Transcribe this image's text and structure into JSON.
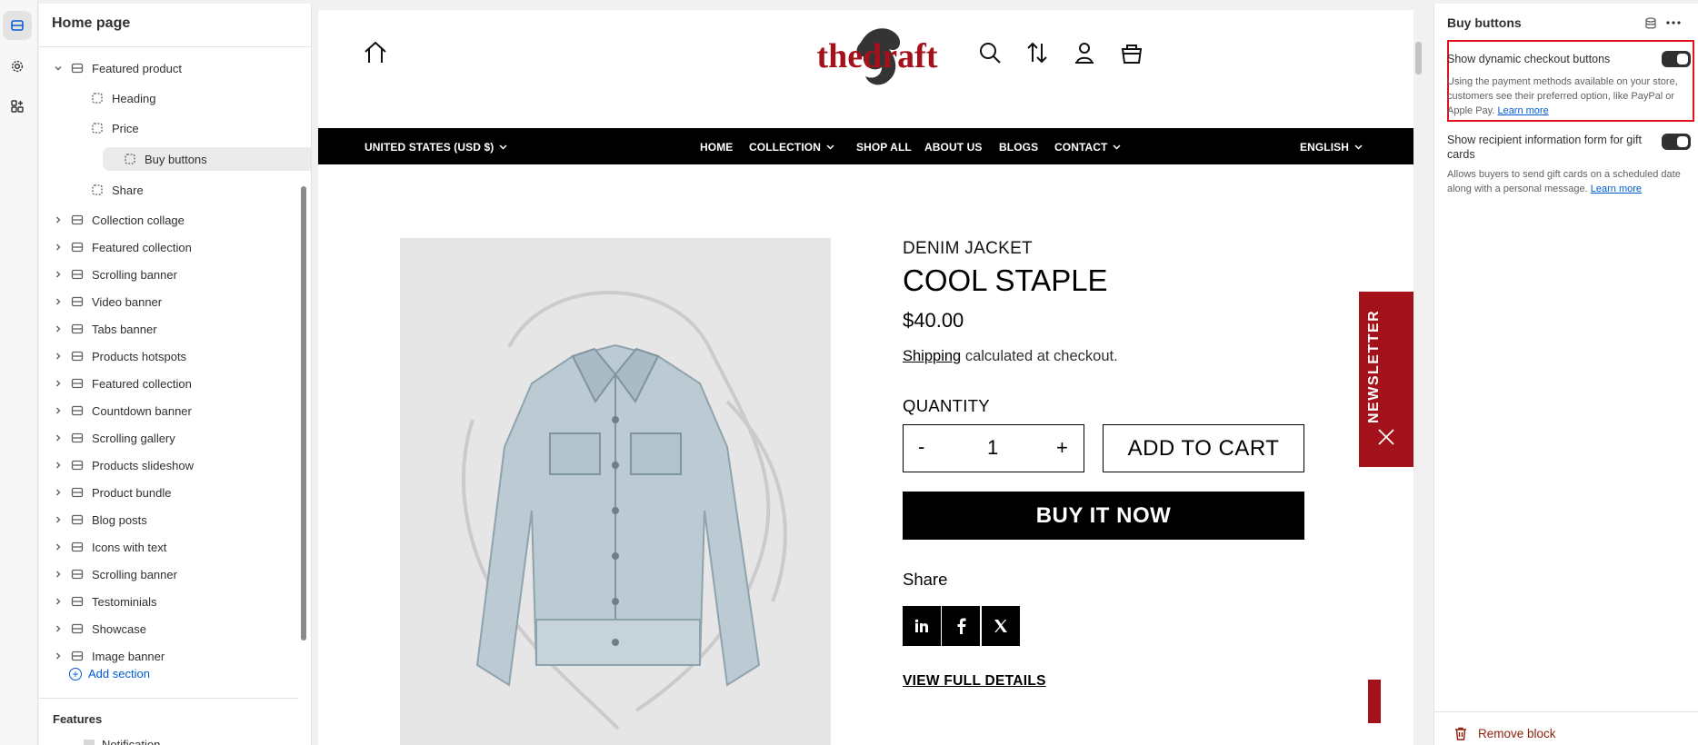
{
  "sidebar": {
    "title": "Home page",
    "items": [
      {
        "label": "Featured product",
        "kind": "section",
        "expanded": true
      },
      {
        "label": "Heading",
        "kind": "child"
      },
      {
        "label": "Price",
        "kind": "child"
      },
      {
        "label": "Buy buttons",
        "kind": "child",
        "selected": true
      },
      {
        "label": "Share",
        "kind": "child"
      },
      {
        "label": "Collection collage",
        "kind": "section"
      },
      {
        "label": "Featured collection",
        "kind": "section"
      },
      {
        "label": "Scrolling banner",
        "kind": "section"
      },
      {
        "label": "Video banner",
        "kind": "section"
      },
      {
        "label": "Tabs banner",
        "kind": "section"
      },
      {
        "label": "Products hotspots",
        "kind": "section"
      },
      {
        "label": "Featured collection",
        "kind": "section"
      },
      {
        "label": "Countdown banner",
        "kind": "section"
      },
      {
        "label": "Scrolling gallery",
        "kind": "section"
      },
      {
        "label": "Products slideshow",
        "kind": "section"
      },
      {
        "label": "Product bundle",
        "kind": "section"
      },
      {
        "label": "Blog posts",
        "kind": "section"
      },
      {
        "label": "Icons with text",
        "kind": "section"
      },
      {
        "label": "Scrolling banner",
        "kind": "section"
      },
      {
        "label": "Testominials",
        "kind": "section"
      },
      {
        "label": "Showcase",
        "kind": "section"
      },
      {
        "label": "Image banner",
        "kind": "section"
      }
    ],
    "add_section": "Add section",
    "features_title": "Features",
    "features_first": "Notification"
  },
  "preview": {
    "logo_text": "thedraft",
    "nav": {
      "currency": "UNITED STATES (USD $)",
      "links": [
        "HOME",
        "COLLECTION",
        "SHOP ALL",
        "ABOUT US",
        "BLOGS",
        "CONTACT"
      ],
      "language": "ENGLISH"
    },
    "product": {
      "eyebrow": "DENIM JACKET",
      "title": "COOL STAPLE",
      "price": "$40.00",
      "shipping_link": "Shipping",
      "shipping_rest": " calculated at checkout.",
      "quantity_label": "QUANTITY",
      "quantity_minus": "-",
      "quantity_value": "1",
      "quantity_plus": "+",
      "add_to_cart": "ADD TO CART",
      "buy_now": "BUY IT NOW",
      "share_label": "Share",
      "view_full": "VIEW FULL DETAILS"
    },
    "newsletter": "NEWSLETTER",
    "colors": {
      "brand_red": "#a3121b",
      "black": "#000000"
    }
  },
  "panel": {
    "title": "Buy buttons",
    "option1": {
      "label": "Show dynamic checkout buttons",
      "help": "Using the payment methods available on your store, customers see their preferred option, like PayPal or Apple Pay.",
      "link": "Learn more",
      "enabled": true
    },
    "option2": {
      "label": "Show recipient information form for gift cards",
      "help": "Allows buyers to send gift cards on a scheduled date along with a personal message.",
      "link": "Learn more",
      "enabled": true
    },
    "remove": "Remove block"
  }
}
